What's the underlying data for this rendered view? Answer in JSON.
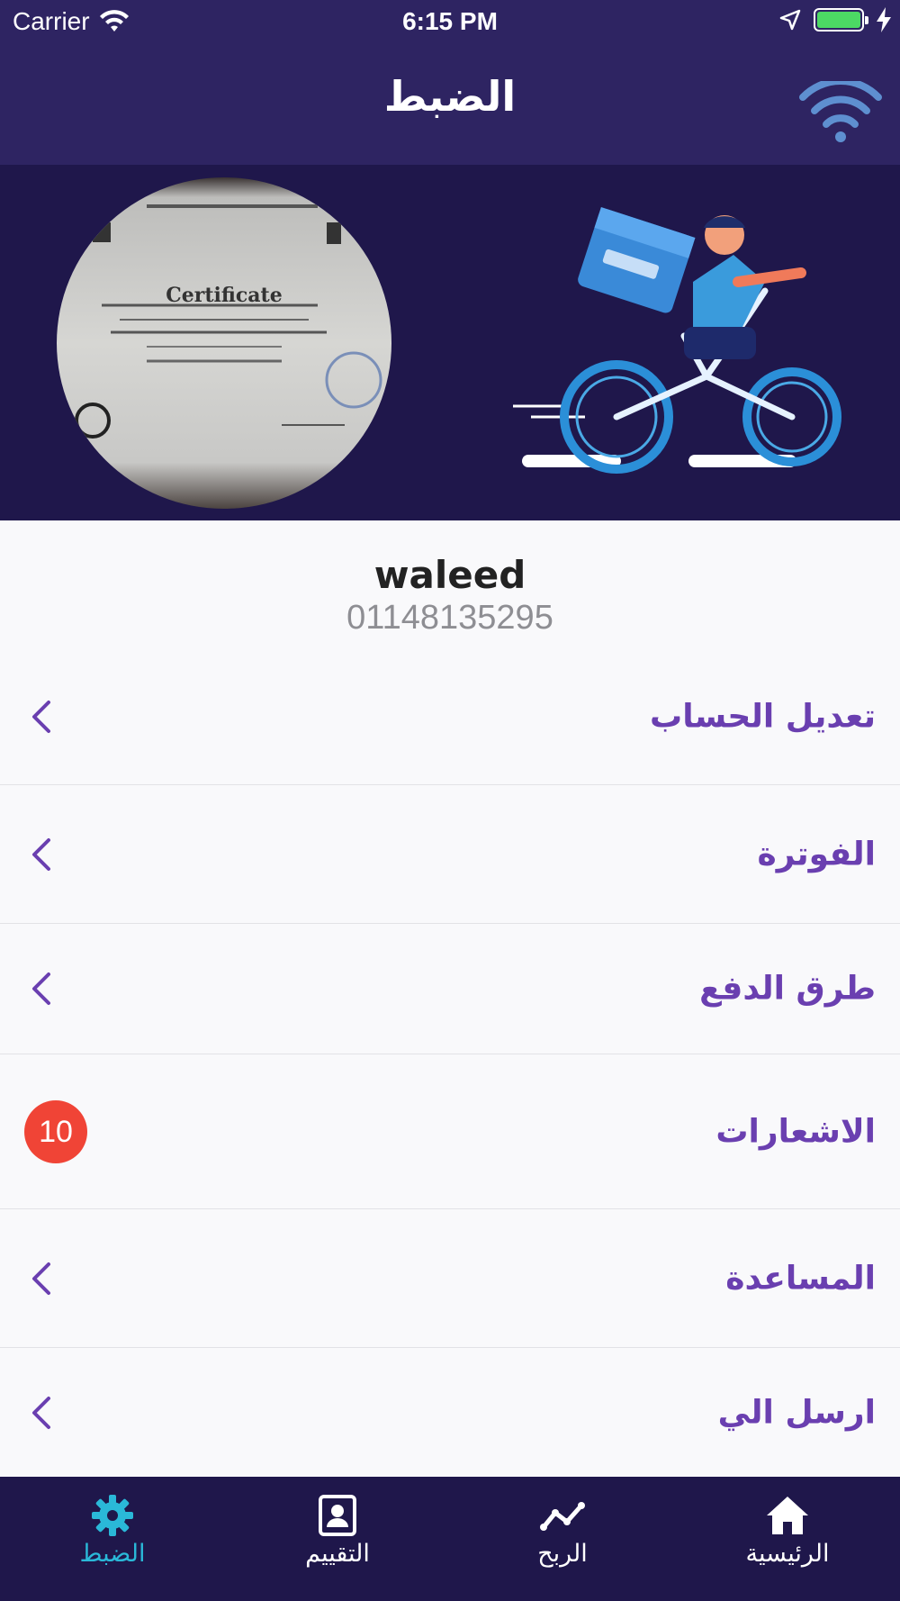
{
  "status_bar": {
    "carrier": "Carrier",
    "time": "6:15 PM",
    "battery_level": 1.0
  },
  "header": {
    "title": "الضبط",
    "wifi_icon": "wifi-icon"
  },
  "banner": {
    "certificate_title": "Certificate"
  },
  "profile": {
    "name": "waleed",
    "phone": "01148135295"
  },
  "menu": {
    "items": [
      {
        "label": "تعديل الحساب",
        "trailing": "chevron-left-icon"
      },
      {
        "label": "الفوترة",
        "trailing": "chevron-left-icon"
      },
      {
        "label": "طرق الدفع",
        "trailing": "chevron-left-icon"
      },
      {
        "label": "الاشعارات",
        "badge": "10"
      },
      {
        "label": "المساعدة",
        "trailing": "chevron-left-icon"
      },
      {
        "label": "ارسل الي",
        "trailing": "chevron-left-icon"
      }
    ]
  },
  "tabs": [
    {
      "label": "الضبط",
      "icon": "gear-icon",
      "active": true
    },
    {
      "label": "التقييم",
      "icon": "contact-card-icon",
      "active": false
    },
    {
      "label": "الربح",
      "icon": "trend-line-icon",
      "active": false
    },
    {
      "label": "الرئيسية",
      "icon": "home-icon",
      "active": false
    }
  ],
  "colors": {
    "header_bg": "#2e2462",
    "banner_bg": "#1f174b",
    "menu_text": "#6a3fb0",
    "badge": "#f04436",
    "active_tab": "#2ab8d8"
  }
}
